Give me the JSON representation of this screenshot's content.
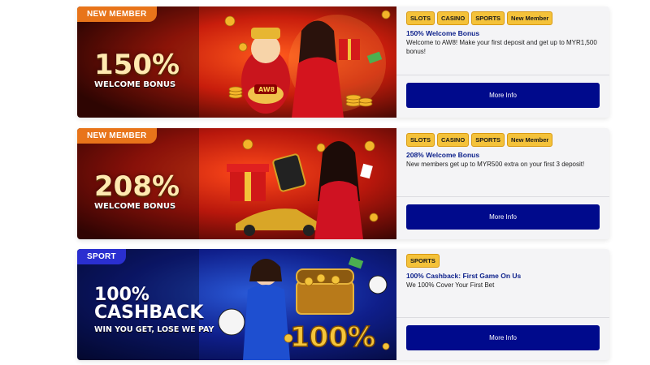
{
  "colors": {
    "button": "#000a8c",
    "tag": "#f4c23a",
    "title": "#0b1f8a",
    "ribbon_orange": "#e8741a",
    "ribbon_blue": "#2a2fd0"
  },
  "promos": [
    {
      "ribbon": "NEW MEMBER",
      "headline": "150%",
      "subline": "WELCOME BONUS",
      "tags": [
        "SLOTS",
        "CASINO",
        "SPORTS",
        "New Member"
      ],
      "title": "150% Welcome Bonus",
      "description": "Welcome to AW8! Make your first deposit and get up to MYR1,500 bonus!",
      "button": "More Info",
      "banner_logo": "AW8"
    },
    {
      "ribbon": "NEW MEMBER",
      "headline": "208%",
      "subline": "WELCOME BONUS",
      "tags": [
        "SLOTS",
        "CASINO",
        "SPORTS",
        "New Member"
      ],
      "title": "208% Welcome Bonus",
      "description": "New members get up to MYR500 extra on your first 3 deposit!",
      "button": "More Info"
    },
    {
      "ribbon": "SPORT",
      "headline": "100%",
      "headline2": "CASHBACK",
      "subline": "WIN YOU GET, LOSE WE PAY",
      "tags": [
        "SPORTS"
      ],
      "title": "100% Cashback: First Game On Us",
      "description": "We 100% Cover Your First Bet",
      "button": "More Info",
      "banner_overlay": "100%"
    }
  ]
}
